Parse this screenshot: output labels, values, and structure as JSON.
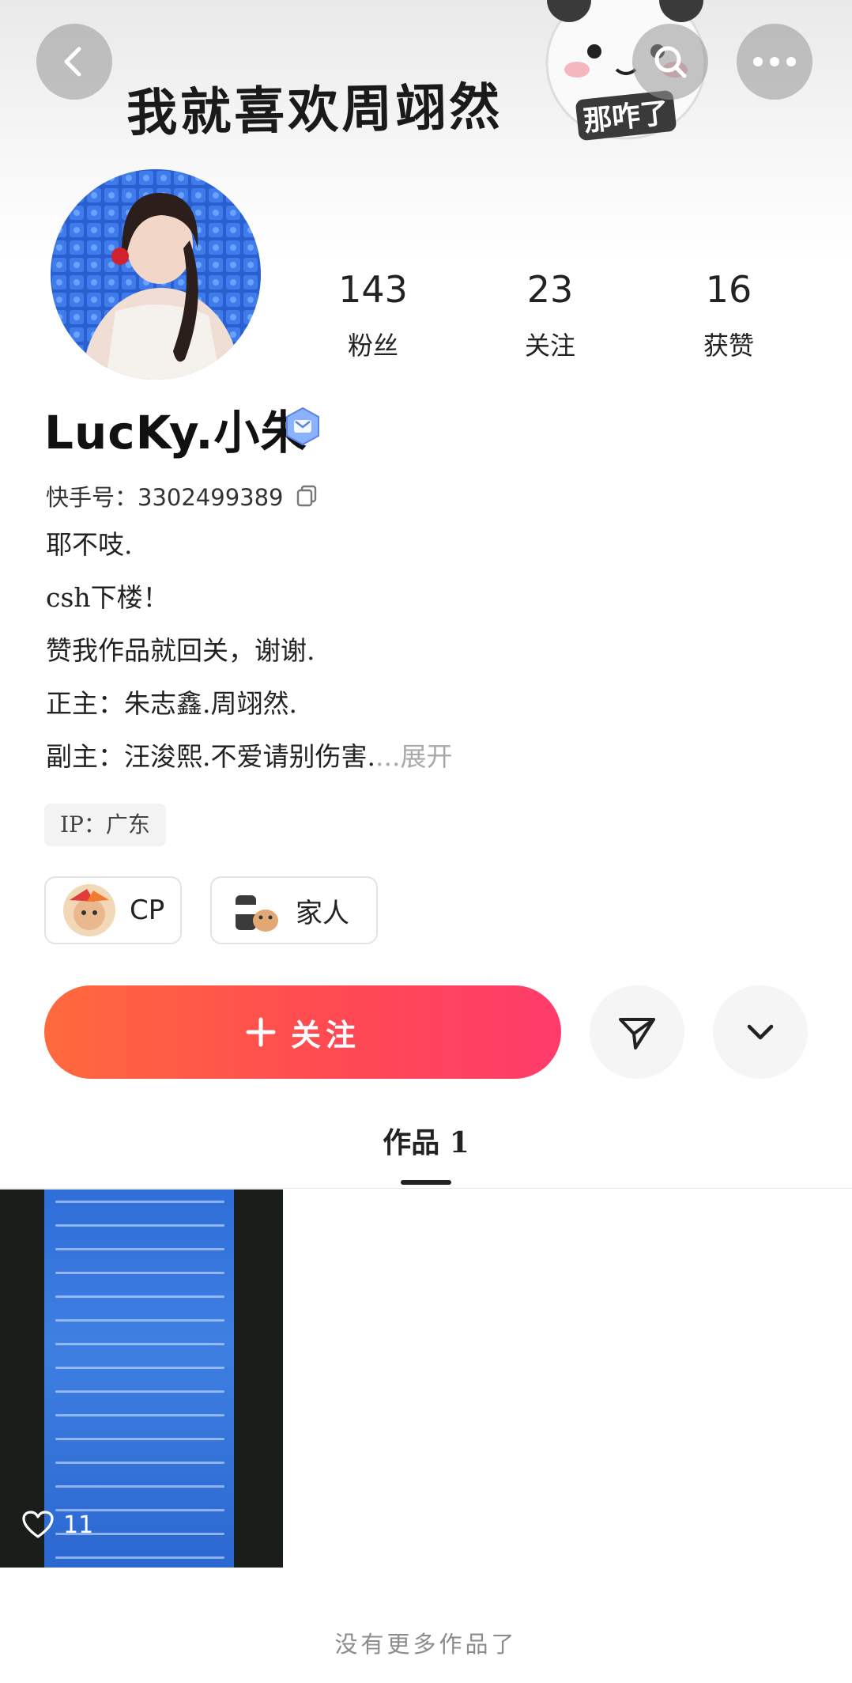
{
  "banner": {
    "text": "我就喜欢周翊然",
    "sticker_caption": "那咋了"
  },
  "stats": [
    {
      "value": "143",
      "label": "粉丝"
    },
    {
      "value": "23",
      "label": "关注"
    },
    {
      "value": "16",
      "label": "获赞"
    }
  ],
  "profile": {
    "name": "LucKy.小朱",
    "kwai_id": "快手号：3302499389",
    "bio": [
      "耶不吱.",
      "csh下楼！",
      "赞我作品就回关，谢谢.",
      "正主：朱志鑫.周翊然."
    ],
    "bio_last": "副主：汪浚熙.不爱请别伤害.",
    "bio_expand": "...展开",
    "ip": "IP：广东"
  },
  "chips": [
    {
      "label": "CP"
    },
    {
      "label": "家人"
    }
  ],
  "actions": {
    "follow_label": "关注"
  },
  "tabs": {
    "works_label": "作品 1"
  },
  "works": [
    {
      "likes": "11"
    }
  ],
  "footer": {
    "no_more": "没有更多作品了"
  },
  "colors": {
    "follow_gradient_start": "#ff6a3d",
    "follow_gradient_end": "#ff3b6b"
  }
}
